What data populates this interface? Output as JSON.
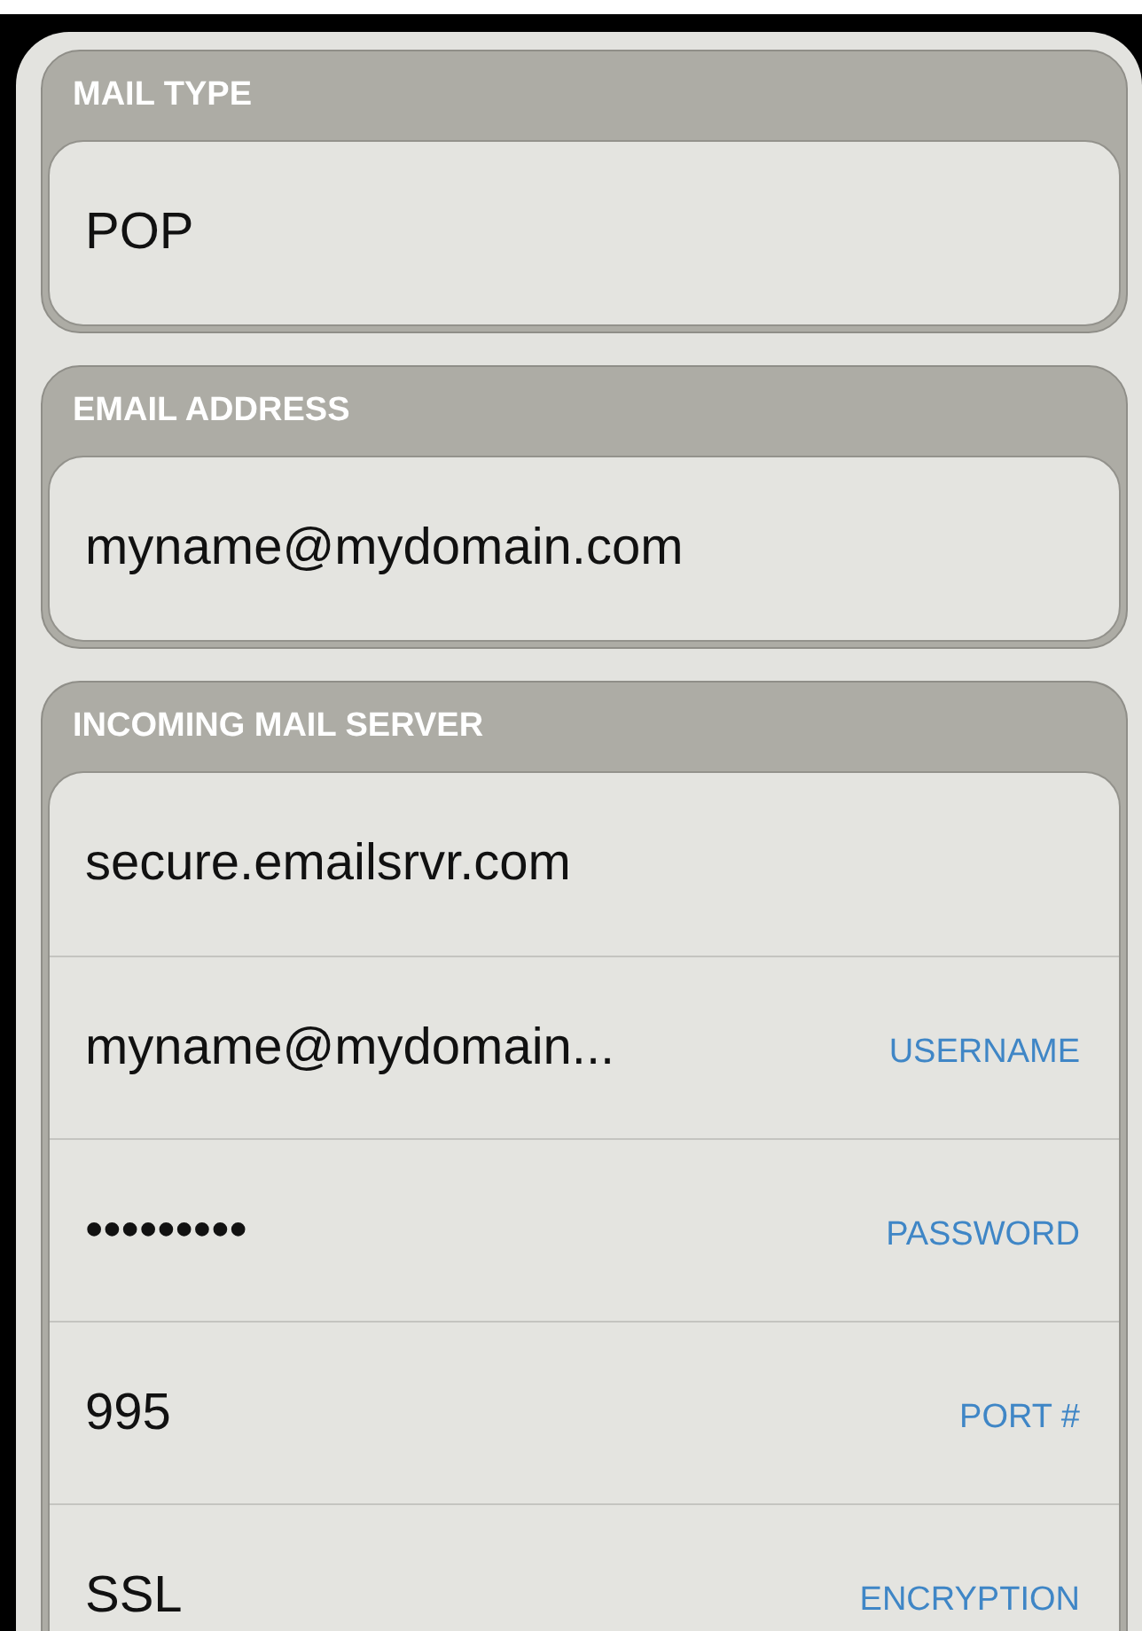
{
  "sections": [
    {
      "title": "MAIL TYPE",
      "fields": [
        {
          "value": "POP"
        }
      ]
    },
    {
      "title": "EMAIL ADDRESS",
      "fields": [
        {
          "value": "myname@mydomain.com"
        }
      ]
    },
    {
      "title": "INCOMING MAIL SERVER",
      "fields": [
        {
          "value": "secure.emailsrvr.com"
        },
        {
          "value": "myname@mydomain...",
          "label": "USERNAME"
        },
        {
          "value": "•••••••••",
          "label": "PASSWORD"
        },
        {
          "value": "995",
          "label": "PORT #"
        },
        {
          "value": "SSL",
          "label": "ENCRYPTION"
        }
      ]
    }
  ]
}
